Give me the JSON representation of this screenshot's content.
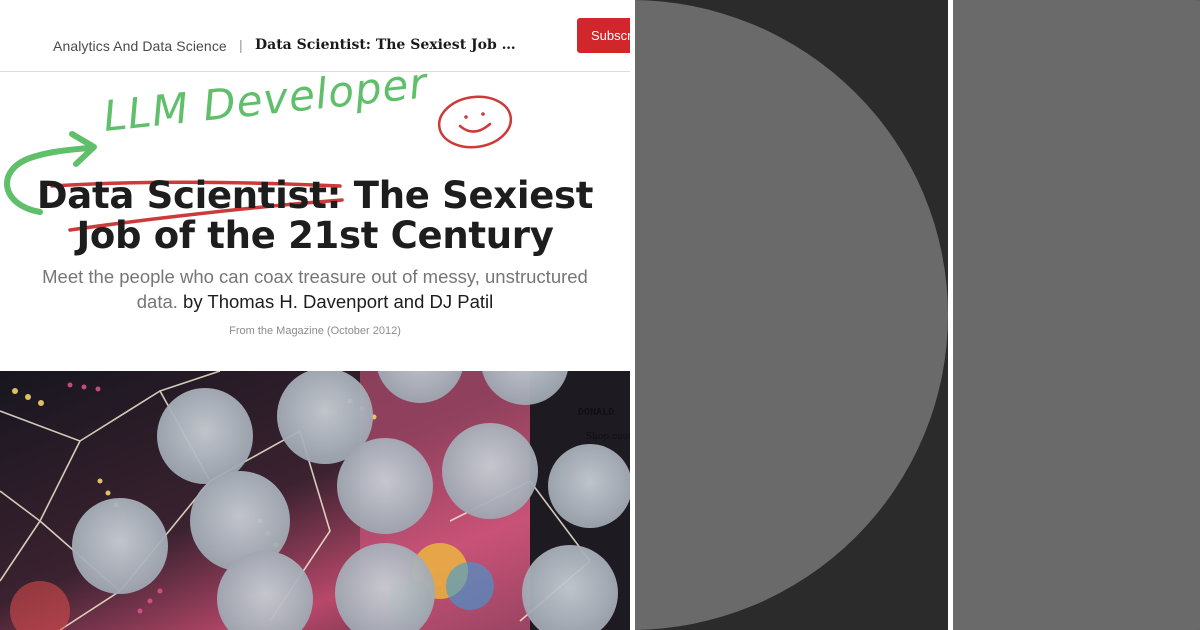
{
  "breadcrumb": {
    "section": "Analytics And Data Science",
    "separator": "|",
    "title": "Data Scientist: The Sexiest Job of th..."
  },
  "header": {
    "subscribe_label": "Subscribe"
  },
  "annotation": {
    "handwritten_text": "LLM Developer",
    "smiley": "smiley-doodle"
  },
  "article": {
    "headline_struck": "Data Scientist",
    "headline_rest_line1": ": The Sexiest",
    "headline_line2": "Job of the 21st Century",
    "dek": "Meet the people who can coax treasure out of messy, unstructured data.",
    "byline": "by Thomas H. Davenport and DJ Patil",
    "pub_info": "From the Magazine (October 2012)"
  },
  "hero_image": {
    "visible_text": [
      "DONALD",
      "Shop course"
    ]
  },
  "colors": {
    "subscribe_red": "#d1262b",
    "handwriting_green": "#5fbf6a",
    "strike_red": "#cc3a3a",
    "tile_background": "#2b2b2b",
    "tile_disc": "#6a6a6a"
  }
}
